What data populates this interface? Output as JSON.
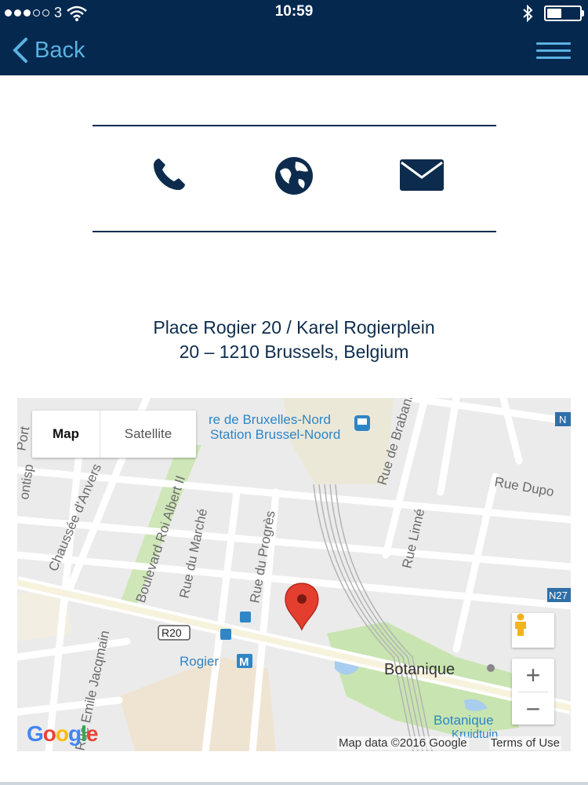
{
  "status_bar": {
    "carrier": "3",
    "time": "10:59"
  },
  "nav": {
    "back_label": "Back"
  },
  "contact": {
    "phone_icon": "phone-icon",
    "web_icon": "globe-icon",
    "mail_icon": "envelope-icon"
  },
  "address": {
    "line1": "Place Rogier 20 / Karel Rogierplein",
    "line2": "20 – 1210 Brussels, Belgium"
  },
  "map": {
    "type_map": "Map",
    "type_satellite": "Satellite",
    "zoom_in": "+",
    "zoom_out": "−",
    "attribution": "Map data ©2016 Google",
    "terms": "Terms of Use",
    "logo": "Google",
    "labels": {
      "station1": "re de Bruxelles-Nord",
      "station2": "Station Brussel-Noord",
      "rue_brabant": "Rue de Brabant",
      "rue_dupo": "Rue Dupo",
      "rue_linne": "Rue Linné",
      "chaussee": "Chaussée d'Anvers",
      "boulevard": "Boulevard Roi Albert II",
      "rue_marche": "Rue du Marché",
      "rue_progres": "Rue du Progrès",
      "ontisp": "ontisp",
      "port": "Port",
      "r20": "R20",
      "rogier": "Rogier",
      "metro": "M",
      "botanique": "Botanique",
      "botanique_kruidtuin_1": "Botanique",
      "botanique_kruidtuin_2": "Kruidtuin",
      "emile": "Rue Emile Jacqmain",
      "n27": "N27",
      "n_left": "N"
    }
  },
  "colors": {
    "header_bg": "#05284f",
    "accent": "#5ab2e1",
    "text_dark": "#0d2c4d"
  }
}
